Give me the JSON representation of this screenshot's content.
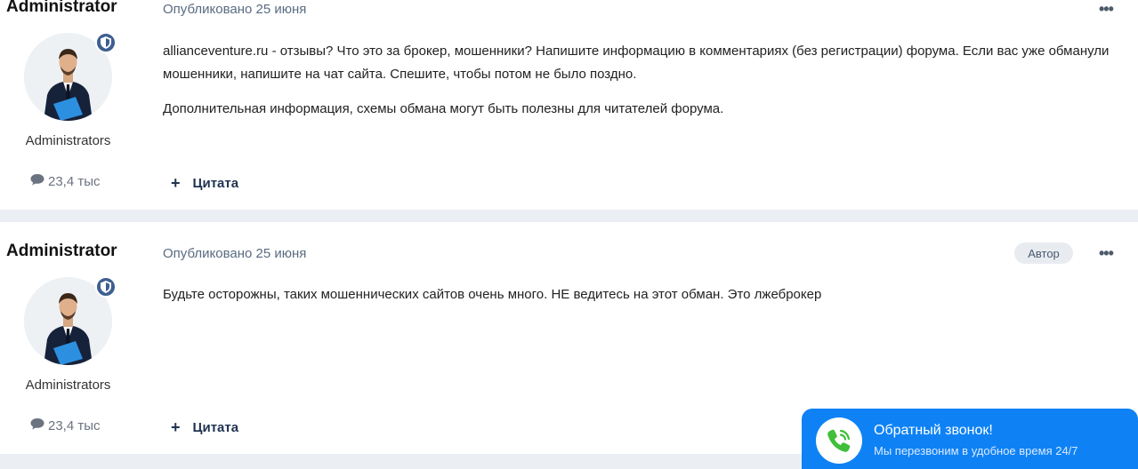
{
  "posts": [
    {
      "author": "Administrator",
      "group": "Administrators",
      "count": "23,4 тыс",
      "date": "Опубликовано 25 июня",
      "paragraphs": [
        "allianceventure.ru - отзывы? Что это за брокер, мошенники? Напишите информацию в комментариях (без регистрации) форума. Если вас уже обманули мошенники, напишите на чат сайта. Спешите, чтобы потом не было поздно.",
        "Дополнительная информация, схемы обмана могут быть полезны для читателей форума."
      ],
      "quote_label": "Цитата",
      "menu": "•••"
    },
    {
      "author": "Administrator",
      "group": "Administrators",
      "count": "23,4 тыс",
      "date": "Опубликовано 25 июня",
      "badge": "Автор",
      "paragraphs": [
        "Будьте осторожны, таких мошеннических сайтов очень много. НЕ ведитесь на этот обман. Это лжеброкер"
      ],
      "quote_label": "Цитата",
      "menu": "•••"
    }
  ],
  "callback": {
    "title": "Обратный звонок!",
    "subtitle": "Мы перезвоним в удобное время 24/7"
  },
  "icons": {
    "shield": "shield-icon",
    "comment": "comment-icon",
    "phone": "phone-icon",
    "plus": "plus-icon"
  },
  "colors": {
    "accent": "#0e82f5",
    "shield": "#3d5f91",
    "link": "#1f3350"
  }
}
